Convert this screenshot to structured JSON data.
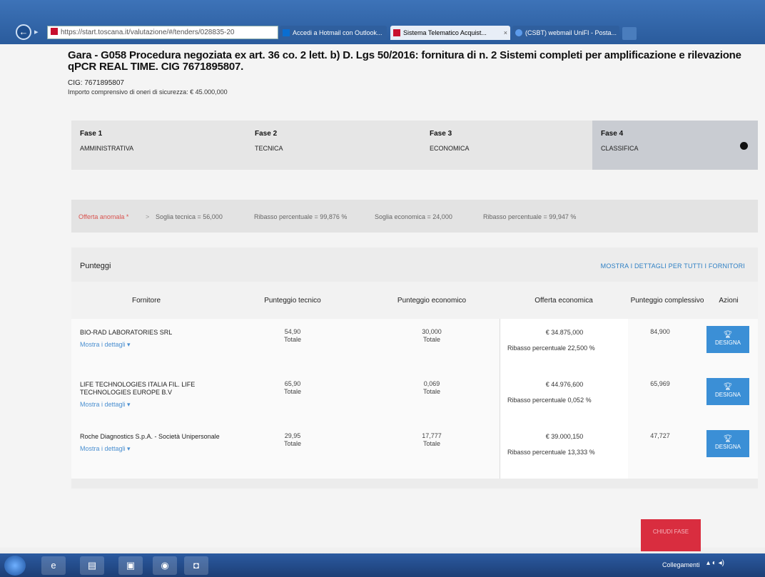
{
  "browser": {
    "address": "https://start.toscana.it/valutazione/#/tenders/028835-20",
    "address_domain": "toscana.it",
    "tabs": [
      {
        "label": "Accedi a Hotmail con Outlook..."
      },
      {
        "label": "Sistema Telematico Acquist..."
      },
      {
        "label": "(CSBT) webmail UniFI - Posta..."
      }
    ]
  },
  "header": {
    "title": "Gara - G058 Procedura negoziata ex art. 36 co. 2 lett. b) D. Lgs 50/2016: fornitura di n. 2 Sistemi completi per amplificazione e rilevazione qPCR REAL TIME. CIG 7671895807.",
    "cig": "CIG: 7671895807",
    "importo": "Importo comprensivo di oneri di sicurezza: € 45.000,000"
  },
  "phases": [
    {
      "num": "Fase 1",
      "name": "AMMINISTRATIVA"
    },
    {
      "num": "Fase 2",
      "name": "TECNICA"
    },
    {
      "num": "Fase 3",
      "name": "ECONOMICA"
    },
    {
      "num": "Fase 4",
      "name": "CLASSIFICA"
    }
  ],
  "thresholds": {
    "anomala": "Offerta anomala *",
    "separator": ">",
    "soglia_tecnica": "Soglia tecnica = 56,000",
    "ribasso_1": "Ribasso percentuale = 99,876 %",
    "soglia_economica": "Soglia economica = 24,000",
    "ribasso_2": "Ribasso percentuale = 99,947 %"
  },
  "results": {
    "label": "Punteggi",
    "show_all": "MOSTRA I DETTAGLI PER TUTTI I FORNITORI",
    "columns": {
      "fornitore": "Fornitore",
      "tecnico": "Punteggio tecnico",
      "economico": "Punteggio economico",
      "offerta": "Offerta economica",
      "complessivo": "Punteggio complessivo",
      "azioni": "Azioni"
    },
    "rows": [
      {
        "fornitore": "BIO-RAD LABORATORIES SRL",
        "details": "Mostra i dettagli",
        "tecnico": "54,90",
        "tecnico_sub": "Totale",
        "economico": "30,000",
        "economico_sub": "Totale",
        "offerta": "€ 34.875,000",
        "ribasso": "Ribasso percentuale  22,500 %",
        "complessivo": "84,900",
        "action": "DESIGNA"
      },
      {
        "fornitore": "LIFE TECHNOLOGIES ITALIA FIL. LIFE TECHNOLOGIES EUROPE B.V",
        "details": "Mostra i dettagli",
        "tecnico": "65,90",
        "tecnico_sub": "Totale",
        "economico": "0,069",
        "economico_sub": "Totale",
        "offerta": "€ 44.976,600",
        "ribasso": "Ribasso percentuale  0,052 %",
        "complessivo": "65,969",
        "action": "DESIGNA"
      },
      {
        "fornitore": "Roche Diagnostics S.p.A. - Società Unipersonale",
        "details": "Mostra i dettagli",
        "tecnico": "29,95",
        "tecnico_sub": "Totale",
        "economico": "17,777",
        "economico_sub": "Totale",
        "offerta": "€ 39.000,150",
        "ribasso": "Ribasso percentuale  13,333 %",
        "complessivo": "47,727",
        "action": "DESIGNA"
      }
    ]
  },
  "footer": {
    "red_button": "CHIUDI FASE"
  },
  "taskbar": {
    "tray_label": "Collegamenti"
  }
}
